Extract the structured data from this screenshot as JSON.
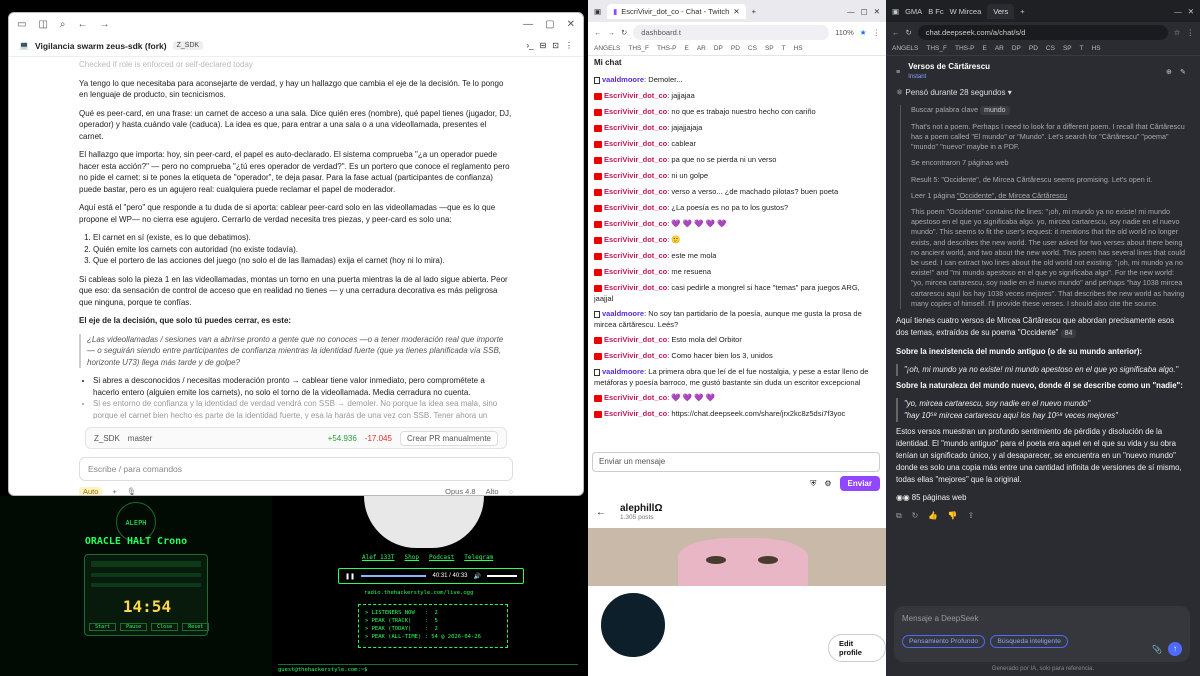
{
  "win1": {
    "title": "Vigilancia swarm zeus-sdk (fork)",
    "badge": "Z_SDK",
    "faded_line": "Checked if role is enforced or self-declared today",
    "paragraphs": [
      "Ya tengo lo que necesitaba para aconsejarte de verdad, y hay un hallazgo que cambia el eje de la decisión. Te lo pongo en lenguaje de producto, sin tecnicismos.",
      "Qué es peer-card, en una frase: un carnet de acceso a una sala. Dice quién eres (nombre), qué papel tienes (jugador, DJ, operador) y hasta cuándo vale (caduca). La idea es que, para entrar a una sala o a una videollamada, presentes el carnet.",
      "El hallazgo que importa: hoy, sin peer-card, el papel es auto-declarado. El sistema comprueba \"¿a un operador puede hacer esta acción?\" — pero no comprueba \"¿tú eres operador de verdad?\". Es un portero que conoce el reglamento pero no pide el carnet: si te pones la etiqueta de \"operador\", te deja pasar. Para la fase actual (participantes de confianza) puede bastar, pero es un agujero real: cualquiera puede reclamar el papel de moderador.",
      "Aquí está el \"pero\" que responde a tu duda de si aporta: cablear peer-card solo en las videollamadas —que es lo que propone el WP— no cierra ese agujero. Cerrarlo de verdad necesita tres piezas, y peer-card es solo una:"
    ],
    "list": [
      "El carnet en sí (existe, es lo que debatimos).",
      "Quién emite los carnets con autoridad (no existe todavía).",
      "Que el portero de las acciones del juego (no solo el de las llamadas) exija el carnet (hoy ni lo mira)."
    ],
    "para2": "Si cableas solo la pieza 1 en las videollamadas, montas un torno en una puerta mientras la de al lado sigue abierta. Peor que eso: da sensación de control de acceso que en realidad no tienes — y una cerradura decorativa es más peligrosa que ninguna, porque te confías.",
    "para3": "El eje de la decisión, que solo tú puedes cerrar, es este:",
    "quote": "¿Las videollamadas / sesiones van a abrirse pronto a gente que no conoces —o a tener moderación real que importe — o seguirán siendo entre participantes de confianza mientras la identidad fuerte (que ya tienes planificada vía SSB, horizonte U73) llega más tarde y de golpe?",
    "bullets": [
      "Si abres a desconocidos / necesitas moderación pronto → cablear tiene valor inmediato, pero comprométete a hacerlo entero (alguien emite los carnets), no solo el torno de la videollamada. Media cerradura no cuenta.",
      "Si es entorno de confianza y la identidad de verdad vendrá con SSB → demoler. No porque la idea sea mala, sino porque el carnet bien hecho es parte de la identidad fuerte, y esa la harás de una vez con SSB. Tener ahora un"
    ],
    "git": {
      "repo": "Z_SDK",
      "branch": "master",
      "add": "+54.936",
      "del": "-17.045",
      "pr": "Crear PR manualmente"
    },
    "input_placeholder": "Escribe / para comandos",
    "mode": "Auto",
    "model": "Opus 4.8",
    "effort": "Alto"
  },
  "oracle": {
    "logo": "ALEPH",
    "title": "ORACLE HALT Crono",
    "time": "14:54",
    "buttons": [
      "Start",
      "Pause",
      "Close",
      "Reset"
    ]
  },
  "radio": {
    "links": [
      "Alef_133T",
      "Shop",
      "Podcast",
      "Telegram"
    ],
    "time": "40:31 / 40:33",
    "stream": "radio.thehackerstyle.com/live.ogg",
    "stats": [
      "> LISTENERS NOW   :  2",
      "> PEAK (TRACK)    :  5",
      "> PEAK (TODAY)    :  2",
      "> PEAK (ALL-TIME) : 54 @ 2026-04-26"
    ],
    "footer": "guest@thehackerstyle.com:~$"
  },
  "twitch": {
    "tab": "EscriVivir_dot_co - Chat - Twitch",
    "url": "dashboard.t",
    "zoom": "110%",
    "bookmarks": [
      "ANGELS",
      "THS_F",
      "THS-P",
      "E",
      "AR",
      "DP",
      "PD",
      "CS",
      "SP",
      "T",
      "HS"
    ],
    "header": "Mi chat",
    "messages": [
      {
        "user": "vaaldmoore",
        "text": "Demoler...",
        "mod": true
      },
      {
        "user": "EscriVivir_dot_co",
        "text": "jajjajaa"
      },
      {
        "user": "EscriVivir_dot_co",
        "text": "no que es trabajo nuestro hecho con cariño"
      },
      {
        "user": "EscriVivir_dot_co",
        "text": "jajajjajaja"
      },
      {
        "user": "EscriVivir_dot_co",
        "text": "cablear"
      },
      {
        "user": "EscriVivir_dot_co",
        "text": "pa que no se pierda ni un verso"
      },
      {
        "user": "EscriVivir_dot_co",
        "text": "ni un golpe"
      },
      {
        "user": "EscriVivir_dot_co",
        "text": "verso a verso... ¿de machado pilotas? buen poeta"
      },
      {
        "user": "EscriVivir_dot_co",
        "text": "¿La poesía es no pa to los gustos?"
      },
      {
        "user": "EscriVivir_dot_co",
        "text": "💜 💜 💜 💜 💜"
      },
      {
        "user": "EscriVivir_dot_co",
        "text": "🙂"
      },
      {
        "user": "EscriVivir_dot_co",
        "text": "este me mola"
      },
      {
        "user": "EscriVivir_dot_co",
        "text": "me resuena"
      },
      {
        "user": "EscriVivir_dot_co",
        "text": "casi pedirle a mongrel si hace \"temas\" para juegos ARG, jaajjal"
      },
      {
        "user": "vaaldmoore",
        "text": "No soy tan partidario de la poesía, aunque me gusta la prosa de mircea cărtărescu. Leés?",
        "mod": true
      },
      {
        "user": "EscriVivir_dot_co",
        "text": "Esto mola del Orbitor"
      },
      {
        "user": "EscriVivir_dot_co",
        "text": "Como hacer bien los 3, unidos"
      },
      {
        "user": "vaaldmoore",
        "text": "La primera obra que leí de el fue nostalgia, y pese a estar lleno de metáforas y poesía barroco, me gustó bastante sin duda un escritor excepcional",
        "mod": true
      },
      {
        "user": "EscriVivir_dot_co",
        "text": "💜 💜 💜 💜"
      },
      {
        "user": "EscriVivir_dot_co",
        "text": "https://chat.deepseek.com/share/jrx2kc8z5dsi7f3yoc"
      }
    ],
    "input_placeholder": "Enviar un mensaje",
    "send": "Enviar"
  },
  "profile": {
    "name": "alephillΩ",
    "posts": "1.305 posts",
    "edit": "Edit profile"
  },
  "deepseek": {
    "tabs": [
      "GMA",
      "B Fc",
      "W Mircea",
      "Vers"
    ],
    "url": "chat.deepseek.com/a/chat/s/d",
    "title": "Versos de Cărtărescu",
    "subtitle": "Instant",
    "thought": "Pensó durante 28 segundos",
    "search": "Buscar palabra clave",
    "search_tag": "mundo",
    "t1": "That's not a poem. Perhaps I need to look for a different poem. I recall that Cărtărescu has a poem called \"El mundo\" or \"Mundo\". Let's search for \"Cărtărescu\" \"poema\" \"mundo\" \"nuevo\" maybe in a PDF.",
    "found": "Se encontraron 7 páginas web",
    "t2": "Result 5: \"Occidente\", de Mircea Cărtărescu seems promising. Let's open it.",
    "read": "Leer 1 página",
    "read_title": "\"Occidente\", de Mircea Cărtărescu",
    "t3": "This poem \"Occidente\" contains the lines: \"¡oh, mi mundo ya no existe! mi mundo apestoso en el que yo significaba algo. yo, mircea cartarescu, soy nadie en el nuevo mundo\". This seems to fit the user's request: it mentions that the old world no longer exists, and describes the new world. The user asked for two verses about there being no ancient world, and two about the new world. This poem has several lines that could be used. I can extract two lines about the old world not existing: \"¡oh, mi mundo ya no existe!\" and \"mi mundo apestoso en el que yo significaba algo\". For the new world: \"yo, mircea cartarescu, soy nadie en el nuevo mundo\" and perhaps \"hay 1038 mircea cartarescu aquí los hay 1038 veces mejores\". That describes the new world as having many copies of himself. I'll provide these verses. I should also cite the source.",
    "a1": "Aquí tienes cuatro versos de Mircea Cărtărescu que abordan precisamente esos dos temas, extraídos de su poema \"Occidente\"",
    "h1": "Sobre la inexistencia del mundo antiguo (o de su mundo anterior):",
    "q1": "\"¡oh, mi mundo ya no existe! mi mundo apestoso en el que yo significaba algo.\"",
    "h2": "Sobre la naturaleza del mundo nuevo, donde él se describe como un \"nadie\":",
    "q2a": "\"yo, mircea cartarescu, soy nadie en el nuevo mundo\"",
    "q2b": "\"hay 10⁵⁸ mircea cartarescu aquí los hay 10⁵⁸ veces mejores\"",
    "a2": "Estos versos muestran un profundo sentimiento de pérdida y disolución de la identidad. El \"mundo antiguo\" para el poeta era aquel en el que su vida y su obra tenían un significado único, y al desaparecer, se encuentra en un \"nuevo mundo\" donde es solo una copia más entre una cantidad infinita de versiones de sí mismo, todas ellas \"mejores\" que la original.",
    "cite": "84",
    "web": "85 páginas web",
    "input_placeholder": "Mensaje a DeepSeek",
    "pill1": "Pensamiento Profundo",
    "pill2": "Búsqueda inteligente",
    "footnote": "Generado por IA, solo para referencia."
  }
}
